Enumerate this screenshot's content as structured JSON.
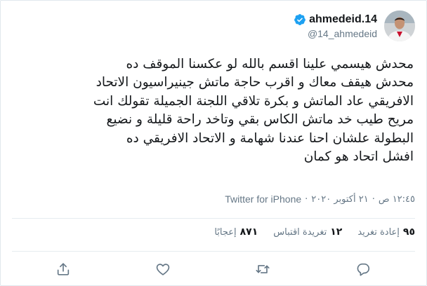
{
  "user": {
    "display_name": "ahmedeid.14",
    "handle": "@14_ahmedeid"
  },
  "tweet": {
    "text": "محدش هيسمي علينا اقسم بالله لو عكسنا الموقف ده\nمحدش هيقف معاك و اقرب حاجة ماتش جينيراسيون الاتحاد\nالافريقي عاد الماتش و بكرة تلاقي اللجنة الجميلة تقولك انت\nمريح طيب خد ماتش الكاس بقي وتاخد راحة قليلة و نضيع\nالبطولة علشان احنا عندنا شهامة و الاتحاد الافريقي ده\nافشل اتحاد هو كمان"
  },
  "meta": {
    "time": "١٢:٤٥ ص",
    "date": "٢١ أكتوبر ٢٠٢٠",
    "separator": "·",
    "source": "Twitter for iPhone"
  },
  "stats": [
    {
      "count": "٩٥",
      "label": "إعادة تغريد"
    },
    {
      "count": "١٢",
      "label": "تغريدة اقتباس"
    },
    {
      "count": "٨٧١",
      "label": "إعجابًا"
    }
  ],
  "colors": {
    "verified": "#1da1f2",
    "secondary_text": "#657786",
    "icon": "#657786",
    "border": "#e6ecf0"
  },
  "icons": [
    "reply-icon",
    "retweet-icon",
    "like-icon",
    "share-icon",
    "verified-badge-icon"
  ]
}
